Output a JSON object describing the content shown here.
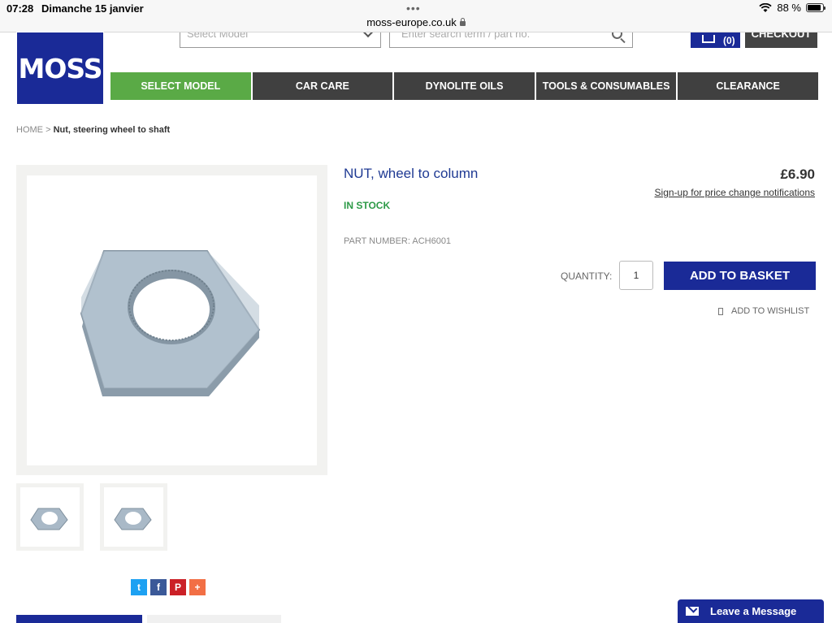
{
  "status_bar": {
    "time": "07:28",
    "date": "Dimanche 15 janvier",
    "battery_text": "88 %",
    "battery_level": 0.88
  },
  "browser": {
    "url": "moss-europe.co.uk"
  },
  "header": {
    "logo_text": "MOSS",
    "select_model_placeholder": "Select Model",
    "search_placeholder": "Enter search term / part no.",
    "cart_count": "(0)",
    "checkout_label": "CHECKOUT"
  },
  "nav": {
    "items": [
      {
        "label": "SELECT MODEL"
      },
      {
        "label": "CAR CARE"
      },
      {
        "label": "DYNOLITE OILS"
      },
      {
        "label": "TOOLS & CONSUMABLES"
      },
      {
        "label": "CLEARANCE"
      }
    ]
  },
  "breadcrumb": {
    "home": "HOME",
    "separator": ">",
    "current": "Nut, steering wheel to shaft"
  },
  "product": {
    "title": "NUT, wheel to column",
    "price": "£6.90",
    "price_notify": "Sign-up for price change notifications",
    "stock": "IN STOCK",
    "part_number": "PART NUMBER: ACH6001",
    "quantity_label": "QUANTITY:",
    "quantity_value": "1",
    "add_button": "ADD TO BASKET",
    "wishlist": "ADD TO WISHLIST"
  },
  "share": {
    "twitter": "t",
    "facebook": "f",
    "pinterest": "P",
    "more": "+"
  },
  "chat": {
    "label": "Leave a Message"
  },
  "colors": {
    "brand_blue": "#1a2a97",
    "nav_green": "#5aaa46",
    "nav_dark": "#404040",
    "stock_green": "#2d9a47",
    "title_blue": "#1f3a93"
  }
}
